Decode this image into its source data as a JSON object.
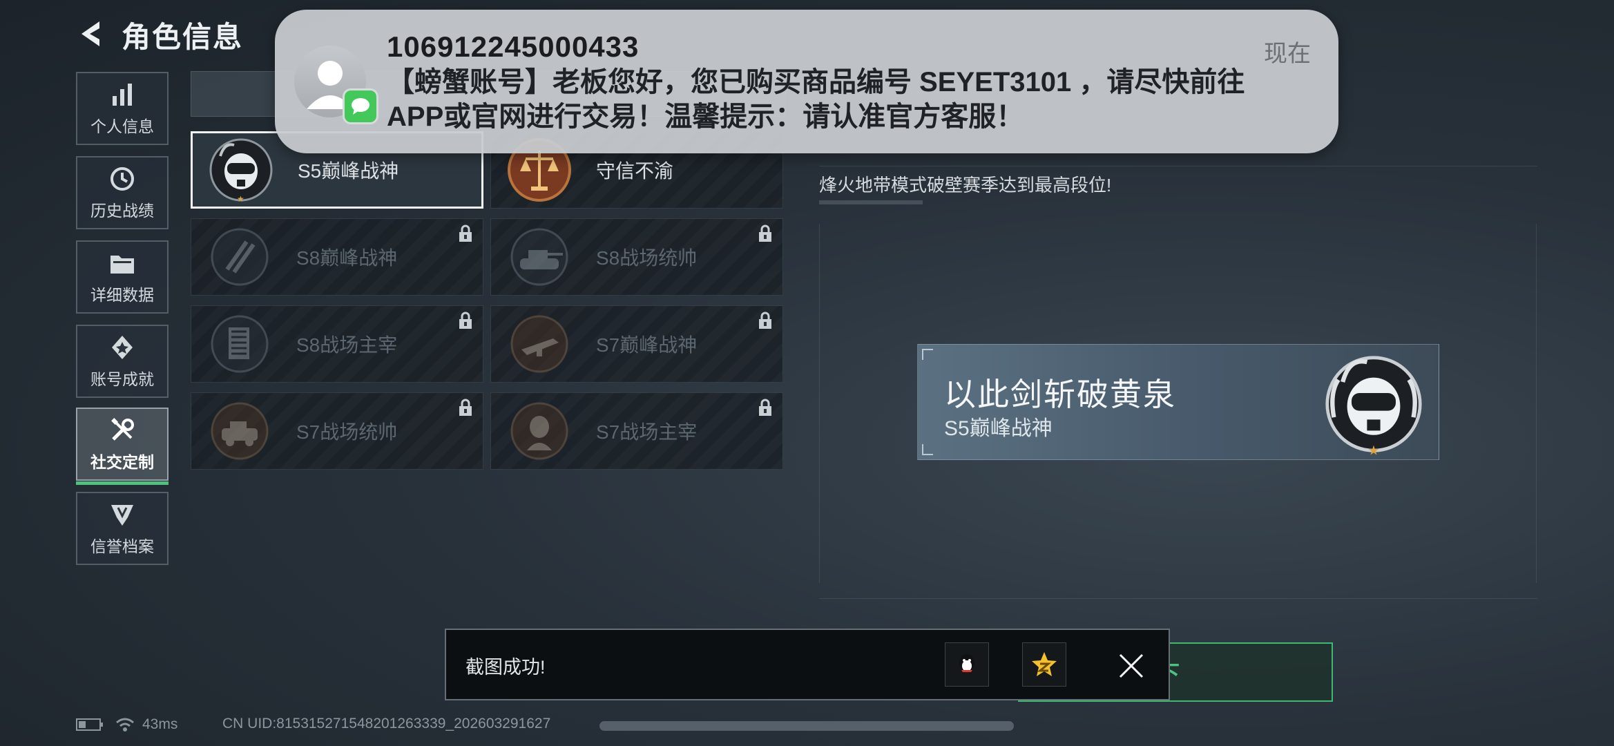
{
  "header": {
    "title": "角色信息",
    "back_icon": "back-arrow-icon"
  },
  "sidebar": {
    "items": [
      {
        "label": "个人信息",
        "icon": "bar-chart-icon",
        "active": false
      },
      {
        "label": "历史战绩",
        "icon": "clock-icon",
        "active": false
      },
      {
        "label": "详细数据",
        "icon": "folder-icon",
        "active": false
      },
      {
        "label": "账号成就",
        "icon": "achievement-icon",
        "active": false
      },
      {
        "label": "社交定制",
        "icon": "tools-icon",
        "active": true
      },
      {
        "label": "信誉档案",
        "icon": "shield-icon",
        "active": false
      }
    ]
  },
  "badges": [
    {
      "name": "S5巅峰战神",
      "locked": false,
      "selected": true
    },
    {
      "name": "守信不渝",
      "locked": false,
      "selected": false
    },
    {
      "name": "S8巅峰战神",
      "locked": true,
      "selected": false
    },
    {
      "name": "S8战场统帅",
      "locked": true,
      "selected": false
    },
    {
      "name": "S8战场主宰",
      "locked": true,
      "selected": false
    },
    {
      "name": "S7巅峰战神",
      "locked": true,
      "selected": false
    },
    {
      "name": "S7战场统帅",
      "locked": true,
      "selected": false
    },
    {
      "name": "S7战场主宰",
      "locked": true,
      "selected": false
    }
  ],
  "detail": {
    "description": "烽火地带模式破壁赛季达到最高段位!",
    "preview_motto": "以此剑斩破黄泉",
    "preview_badge": "S5巅峰战神",
    "equip_button": "卸下"
  },
  "toast": {
    "message": "截图成功!",
    "share_icons": [
      "qq-icon",
      "qzone-icon"
    ]
  },
  "status": {
    "ping": "43ms",
    "uid": "CN UID:815315271548201263339_202603291627"
  },
  "notification": {
    "sender": "106912245000433",
    "time": "现在",
    "body": "【螃蟹账号】老板您好，您已购买商品编号 SEYET3101 ，请尽快前往APP或官网进行交易！温馨提示：请认准官方客服！"
  },
  "colors": {
    "accent_green": "#4ec27e",
    "background": "#28313a",
    "notification_bg": "#c8cbcf"
  }
}
